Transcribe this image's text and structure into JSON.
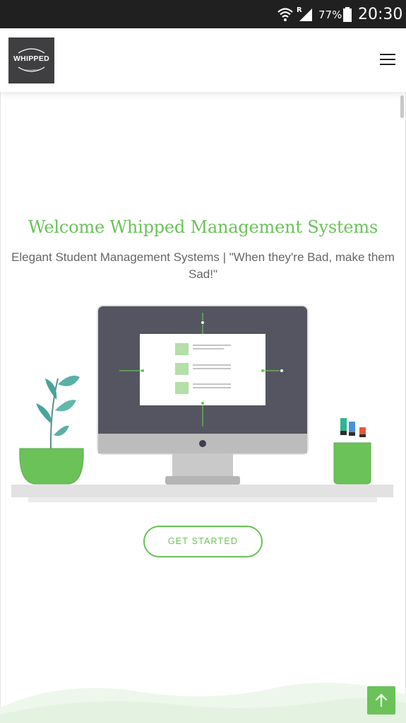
{
  "status_bar": {
    "battery_percent": "77%",
    "time": "20:30",
    "signal_label": "R",
    "icons": [
      "wifi-icon",
      "signal-icon",
      "battery-icon"
    ]
  },
  "navbar": {
    "logo_text": "WHIPPED",
    "logo_subtext": "MANAGEMENT",
    "menu_icon": "hamburger-icon"
  },
  "hero": {
    "title": "Welcome Whipped Management Systems",
    "subtitle": "Elegant Student Management Systems | \"When they're Bad, make them Sad!\"",
    "cta_label": "GET STARTED"
  },
  "back_to_top": {
    "icon": "arrow-up-icon"
  },
  "colors": {
    "accent": "#6ac259",
    "monitor": "#545560",
    "status_bar": "#202020"
  }
}
